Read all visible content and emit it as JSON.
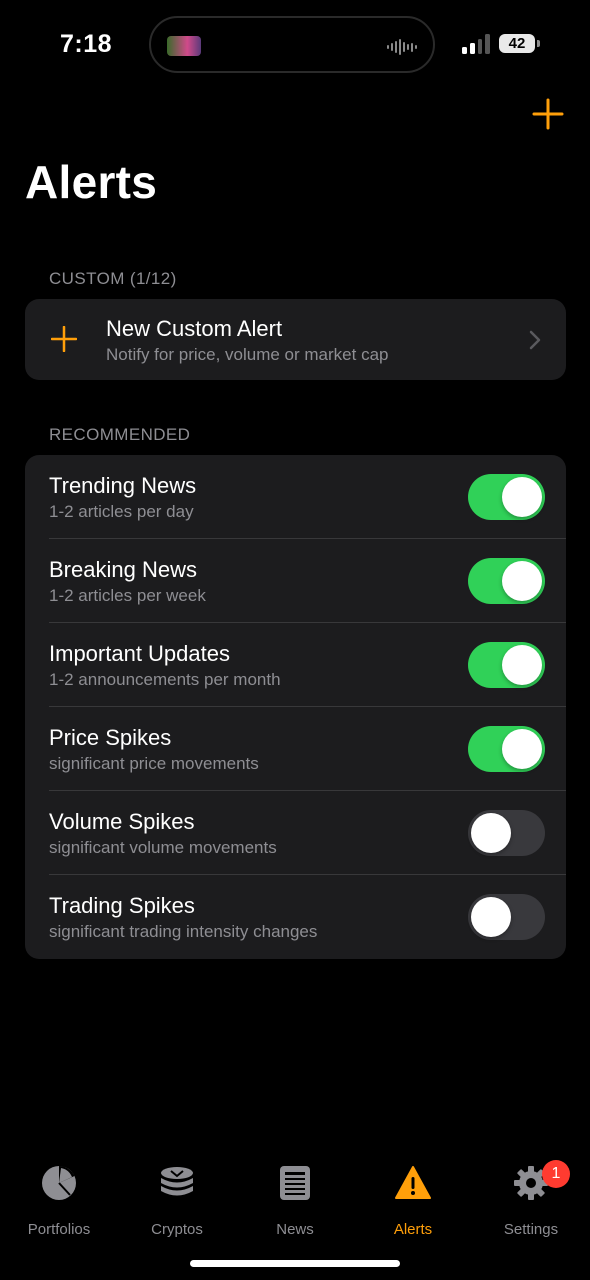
{
  "status_bar": {
    "time": "7:18",
    "battery": "42"
  },
  "header": {
    "add_icon": "plus-icon",
    "title": "Alerts"
  },
  "custom": {
    "section_label": "CUSTOM (1/12)",
    "new_alert_title": "New Custom Alert",
    "new_alert_subtitle": "Notify for price, volume or market cap"
  },
  "recommended": {
    "section_label": "RECOMMENDED",
    "items": [
      {
        "title": "Trending News",
        "subtitle": "1-2 articles per day",
        "enabled": true
      },
      {
        "title": "Breaking News",
        "subtitle": "1-2 articles per week",
        "enabled": true
      },
      {
        "title": "Important Updates",
        "subtitle": "1-2 announcements per month",
        "enabled": true
      },
      {
        "title": "Price Spikes",
        "subtitle": "significant price movements",
        "enabled": true
      },
      {
        "title": "Volume Spikes",
        "subtitle": "significant volume movements",
        "enabled": false
      },
      {
        "title": "Trading Spikes",
        "subtitle": "significant trading intensity changes",
        "enabled": false
      }
    ]
  },
  "tab_bar": {
    "tabs": [
      {
        "label": "Portfolios",
        "icon": "pie-chart-icon",
        "active": false
      },
      {
        "label": "Cryptos",
        "icon": "coin-stack-icon",
        "active": false
      },
      {
        "label": "News",
        "icon": "newspaper-icon",
        "active": false
      },
      {
        "label": "Alerts",
        "icon": "warning-triangle-icon",
        "active": true
      },
      {
        "label": "Settings",
        "icon": "gear-icon",
        "active": false,
        "badge": "1"
      }
    ]
  },
  "colors": {
    "accent": "#ff9f0a",
    "toggle_on": "#30d158",
    "toggle_off": "#39393d",
    "card_bg": "#1c1c1e",
    "secondary_text": "#8e8e93",
    "badge": "#ff3b30"
  }
}
